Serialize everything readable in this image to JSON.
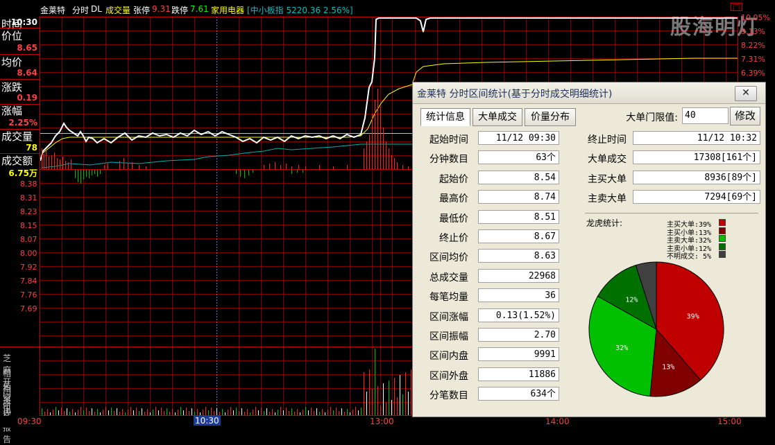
{
  "header": {
    "stock_name": "金莱特",
    "mode": "分时",
    "dl": "DL",
    "indicator": "成交量",
    "limit_up_label": "张停",
    "limit_up": "9.31",
    "limit_down_label": "跌停",
    "limit_down": "7.61",
    "sector": "家用电器",
    "index": "[中小板指 5220.36 2.56%]"
  },
  "info": {
    "time_label": "时间",
    "time": "10:30",
    "price_label": "价位",
    "price": "8.65",
    "avg_label": "均价",
    "avg": "8.64",
    "change_label": "涨跌",
    "change": "0.19",
    "pct_label": "涨幅",
    "pct": "2.25%",
    "vol_label": "成交量",
    "vol": "78",
    "amt_label": "成交额",
    "amt": "6.75万"
  },
  "y_axis_left": [
    "8.38",
    "8.31",
    "8.23",
    "8.15",
    "8.07",
    "8.00",
    "7.92",
    "7.84",
    "7.76",
    "7.69"
  ],
  "y_axis_right": [
    "10.05%",
    "9.13%",
    "8.22%",
    "7.31%",
    "6.39%"
  ],
  "side_links": [
    "芝麻开门",
    "相关资讯",
    "相关评论",
    "研究报告"
  ],
  "time_axis": [
    "09:30",
    "10:30",
    "13:00",
    "14:00",
    "15:00"
  ],
  "watermark": "股海明灯",
  "colors": {
    "price_line": "#ffffff",
    "avg_line": "#ffff00",
    "red": "#ff2020",
    "green": "#00c000",
    "cyan": "#00c0c0",
    "grid": "#800000"
  },
  "dialog": {
    "title": "金莱特 分时区间统计(基于分时成交明细统计)",
    "tabs": [
      "统计信息",
      "大单成交",
      "价量分布"
    ],
    "threshold_label": "大单门限值:",
    "threshold_value": "40",
    "modify_button": "修改",
    "left_fields": [
      {
        "label": "起始时间",
        "value": "11/12 09:30"
      },
      {
        "label": "分钟数目",
        "value": "63个"
      },
      {
        "label": "起始价",
        "value": "8.54"
      },
      {
        "label": "最高价",
        "value": "8.74"
      },
      {
        "label": "最低价",
        "value": "8.51"
      },
      {
        "label": "终止价",
        "value": "8.67"
      },
      {
        "label": "区间均价",
        "value": "8.63"
      },
      {
        "label": "总成交量",
        "value": "22968"
      },
      {
        "label": "每笔均量",
        "value": "36"
      },
      {
        "label": "区间涨幅",
        "value": "0.13(1.52%)"
      },
      {
        "label": "区间振幅",
        "value": "2.70"
      },
      {
        "label": "区间内盘",
        "value": "9991"
      },
      {
        "label": "区间外盘",
        "value": "11886"
      },
      {
        "label": "分笔数目",
        "value": "634个"
      }
    ],
    "right_fields": [
      {
        "label": "终止时间",
        "value": "11/12 10:32"
      },
      {
        "label": "大单成交",
        "value": "17308[161个]"
      },
      {
        "label": "主买大单",
        "value": "8936[89个]"
      },
      {
        "label": "主卖大单",
        "value": "7294[69个]"
      }
    ],
    "pie_title": "龙虎统计:",
    "pie_legend": [
      "主买大单:39%",
      "主买小单:13%",
      "主卖大单:32%",
      "主卖小单:12%",
      "不明成交: 5%"
    ],
    "pie_labels": [
      "39%",
      "13%",
      "32%",
      "12%"
    ]
  },
  "chart_data": {
    "type": "pie",
    "title": "龙虎统计:",
    "slices": [
      {
        "name": "主买大单",
        "value": 39,
        "color": "#c00000"
      },
      {
        "name": "主买小单",
        "value": 13,
        "color": "#800000"
      },
      {
        "name": "主卖大单",
        "value": 32,
        "color": "#00c000"
      },
      {
        "name": "主卖小单",
        "value": 12,
        "color": "#007000"
      },
      {
        "name": "不明成交",
        "value": 5,
        "color": "#404040"
      }
    ]
  }
}
